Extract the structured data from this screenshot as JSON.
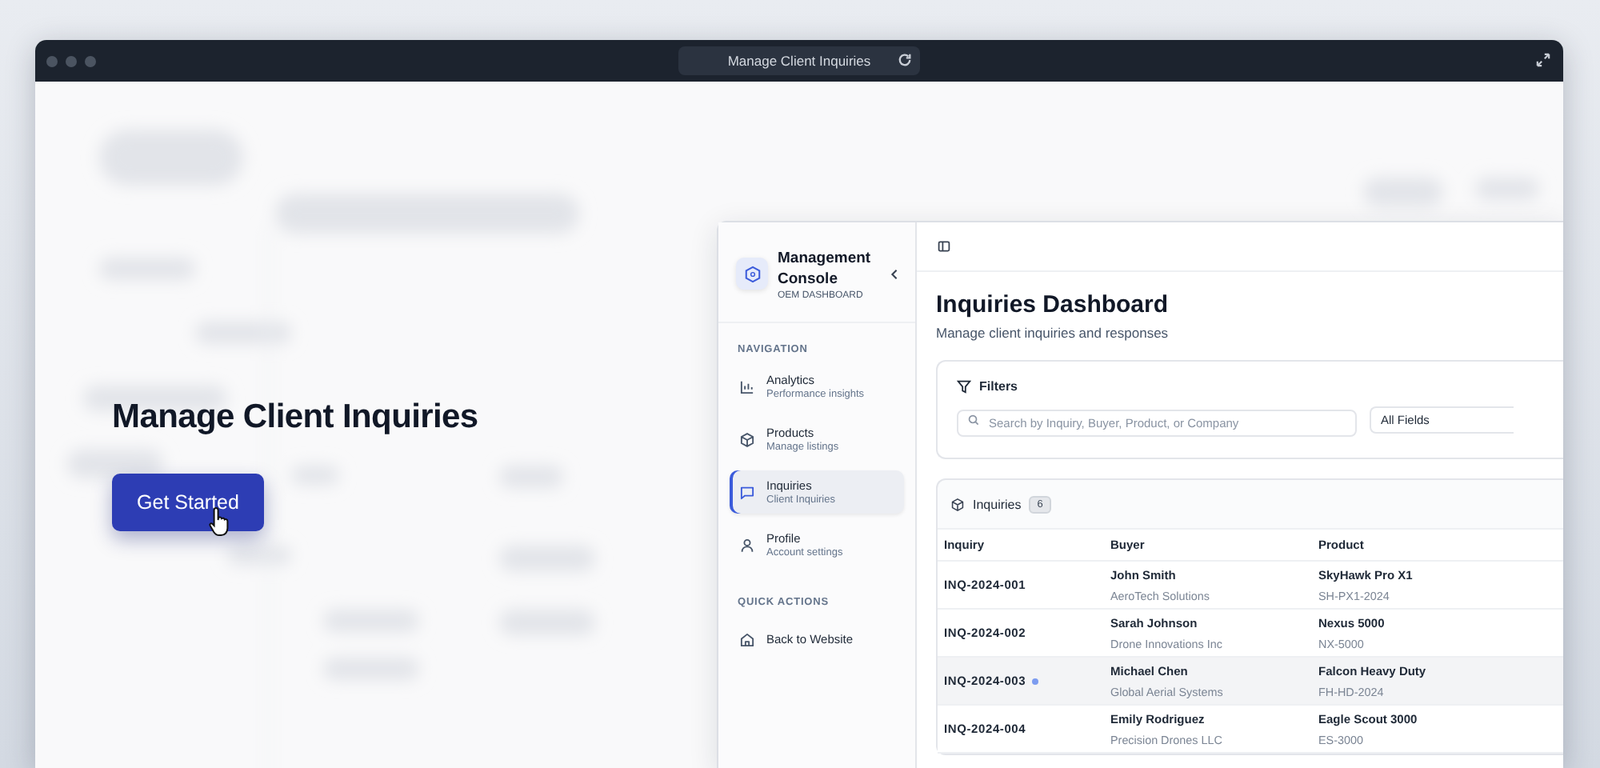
{
  "browser": {
    "title": "Manage Client Inquiries"
  },
  "hero": {
    "heading": "Manage Client Inquiries",
    "button": "Get Started"
  },
  "sidebar": {
    "title": "Management Console",
    "subtitle": "OEM DASHBOARD",
    "sections": [
      {
        "label": "NAVIGATION",
        "items": [
          {
            "kind": "analytics",
            "title": "Analytics",
            "subtitle": "Performance insights",
            "selected": false
          },
          {
            "kind": "products",
            "title": "Products",
            "subtitle": "Manage listings",
            "selected": false
          },
          {
            "kind": "inquiries",
            "title": "Inquiries",
            "subtitle": "Client Inquiries",
            "selected": true
          },
          {
            "kind": "profile",
            "title": "Profile",
            "subtitle": "Account settings",
            "selected": false
          }
        ]
      },
      {
        "label": "QUICK ACTIONS",
        "items": [
          {
            "kind": "home",
            "title": "Back to Website",
            "selected": false
          }
        ]
      }
    ]
  },
  "main": {
    "title": "Inquiries Dashboard",
    "subtitle": "Manage client inquiries and responses",
    "filters": {
      "label": "Filters",
      "search": {
        "placeholder": "Search by Inquiry, Buyer, Product, or Company"
      },
      "field_select": "All Fields"
    },
    "table": {
      "label": "Inquiries",
      "count": "6",
      "columns": [
        "Inquiry",
        "Buyer",
        "Product"
      ],
      "rows": [
        {
          "inquiry": "INQ-2024-001",
          "buyer": "John Smith",
          "company": "AeroTech Solutions",
          "product": "SkyHawk Pro X1",
          "sku": "SH-PX1-2024",
          "unread": false,
          "selected": false
        },
        {
          "inquiry": "INQ-2024-002",
          "buyer": "Sarah Johnson",
          "company": "Drone Innovations Inc",
          "product": "Nexus 5000",
          "sku": "NX-5000",
          "unread": false,
          "selected": false
        },
        {
          "inquiry": "INQ-2024-003",
          "buyer": "Michael Chen",
          "company": "Global Aerial Systems",
          "product": "Falcon Heavy Duty",
          "sku": "FH-HD-2024",
          "unread": true,
          "selected": true
        },
        {
          "inquiry": "INQ-2024-004",
          "buyer": "Emily Rodriguez",
          "company": "Precision Drones LLC",
          "product": "Eagle Scout 3000",
          "sku": "ES-3000",
          "unread": false,
          "selected": false
        }
      ]
    }
  }
}
